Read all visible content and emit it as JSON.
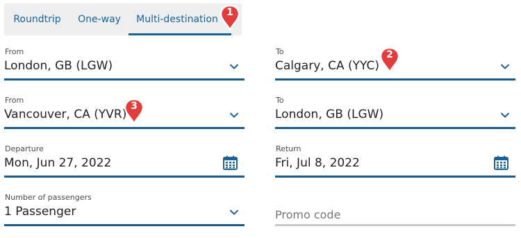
{
  "tabs": [
    {
      "label": "Roundtrip"
    },
    {
      "label": "One-way"
    },
    {
      "label": "Multi-destination",
      "active": true
    }
  ],
  "leg1": {
    "from_label": "From",
    "from_value": "London, GB (LGW)",
    "to_label": "To",
    "to_value": "Calgary, CA (YYC)"
  },
  "leg2": {
    "from_label": "From",
    "from_value": "Vancouver, CA (YVR)",
    "to_label": "To",
    "to_value": "London, GB (LGW)"
  },
  "dates": {
    "departure_label": "Departure",
    "departure_value": "Mon, Jun 27, 2022",
    "return_label": "Return",
    "return_value": "Fri, Jul 8, 2022"
  },
  "passengers": {
    "label": "Number of passengers",
    "value": "1 Passenger"
  },
  "promo": {
    "placeholder": "Promo code"
  },
  "markers": [
    "1",
    "2",
    "3"
  ],
  "colors": {
    "accent": "#1d6296",
    "underline": "#1a5a8c",
    "marker": "#e23d3d",
    "tab_bg": "#edeef0"
  },
  "icons": {
    "dropdown": "chevron-down-icon",
    "calendar": "calendar-icon",
    "marker": "map-pin-icon"
  }
}
